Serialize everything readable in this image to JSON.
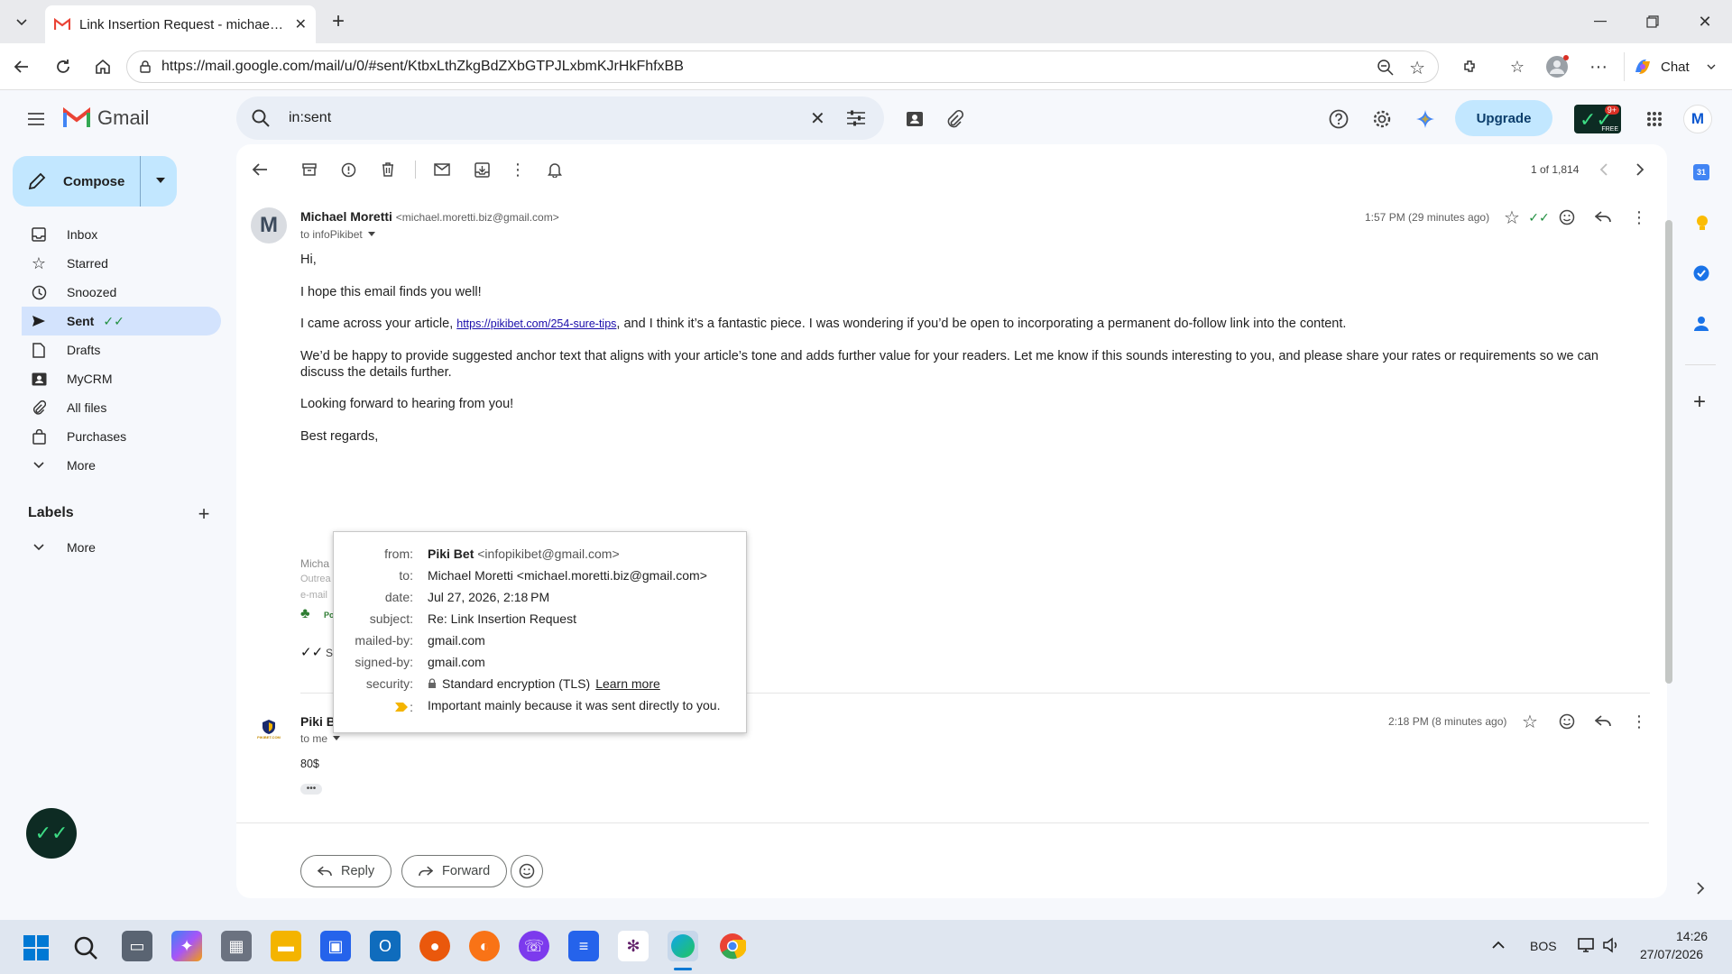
{
  "browser": {
    "tab_title": "Link Insertion Request - michael.m",
    "url": "https://mail.google.com/mail/u/0/#sent/KtbxLthZkgBdZXbGTPJLxbmKJrHkFhfxBB",
    "chat_label": "Chat"
  },
  "gmail": {
    "brand": "Gmail",
    "compose_label": "Compose",
    "search_value": "in:sent",
    "upgrade_label": "Upgrade",
    "account_initial": "M",
    "badge_text": "9+",
    "free_text": "FREE"
  },
  "sidebar": {
    "items": [
      {
        "label": "Inbox",
        "icon": "inbox-icon"
      },
      {
        "label": "Starred",
        "icon": "star-icon"
      },
      {
        "label": "Snoozed",
        "icon": "clock-icon"
      },
      {
        "label": "Sent",
        "icon": "send-icon"
      },
      {
        "label": "Drafts",
        "icon": "draft-icon"
      },
      {
        "label": "MyCRM",
        "icon": "contact-card-icon"
      },
      {
        "label": "All files",
        "icon": "paperclip-icon"
      },
      {
        "label": "Purchases",
        "icon": "bag-icon"
      },
      {
        "label": "More",
        "icon": "chevron-down-icon"
      }
    ],
    "labels_heading": "Labels",
    "labels_more": "More"
  },
  "toolbar": {
    "pager": "1 of 1,814"
  },
  "message1": {
    "sender_name": "Michael Moretti",
    "sender_email": "<michael.moretti.biz@gmail.com>",
    "to_line": "to infoPikibet",
    "time": "1:57 PM (29 minutes ago)",
    "avatar_initial": "M",
    "greeting": "Hi,",
    "para1": "I hope this email finds you well!",
    "para2_before": "I came across your article, ",
    "para2_link": "https://pikibet.com/254-sure-tips",
    "para2_after": ", and I think it’s a fantastic piece. I was wondering if you’d be open to incorporating a permanent do-follow link into the content.",
    "para3": "We’d be happy to provide suggested anchor text that aligns with your article’s tone and adds further value for your readers. Let me know if this sounds interesting to you, and please share your rates or requirements so we can discuss the details further.",
    "para4": "Looking forward to hearing from you!",
    "signoff": "Best regards,",
    "sig_name_partial": "Micha",
    "sig_line2_partial": "Outrea",
    "sig_line3_partial": "e-mail",
    "sig_line4_partial": "Po",
    "sig_line5_partial": "S"
  },
  "message2": {
    "sender_partial": "Piki B",
    "to_line": "to me",
    "time": "2:18 PM (8 minutes ago)",
    "body": "80$",
    "avatar_text": "PIKIBET.COM"
  },
  "popup": {
    "rows": [
      {
        "label": "from:",
        "value_bold": "Piki Bet",
        "value": "<infopikibet@gmail.com>"
      },
      {
        "label": "to:",
        "value": "Michael Moretti <michael.moretti.biz@gmail.com>"
      },
      {
        "label": "date:",
        "value": "Jul 27, 2026, 2:18 PM"
      },
      {
        "label": "subject:",
        "value": "Re: Link Insertion Request"
      },
      {
        "label": "mailed-by:",
        "value": "gmail.com"
      },
      {
        "label": "signed-by:",
        "value": "gmail.com"
      },
      {
        "label": "security:",
        "value": "Standard encryption (TLS)",
        "link": "Learn more"
      },
      {
        "label": ":",
        "value": "Important mainly because it was sent directly to you."
      }
    ]
  },
  "actions": {
    "reply_label": "Reply",
    "forward_label": "Forward"
  },
  "taskbar": {
    "language": "BOS",
    "time": "14:26",
    "date": "27/07/2026"
  },
  "colors": {
    "gmail_red": "#ea4335",
    "active_blue": "#d3e3fd",
    "upgrade_bg": "#c2e7ff",
    "sent_check": "#1e8e3e"
  }
}
